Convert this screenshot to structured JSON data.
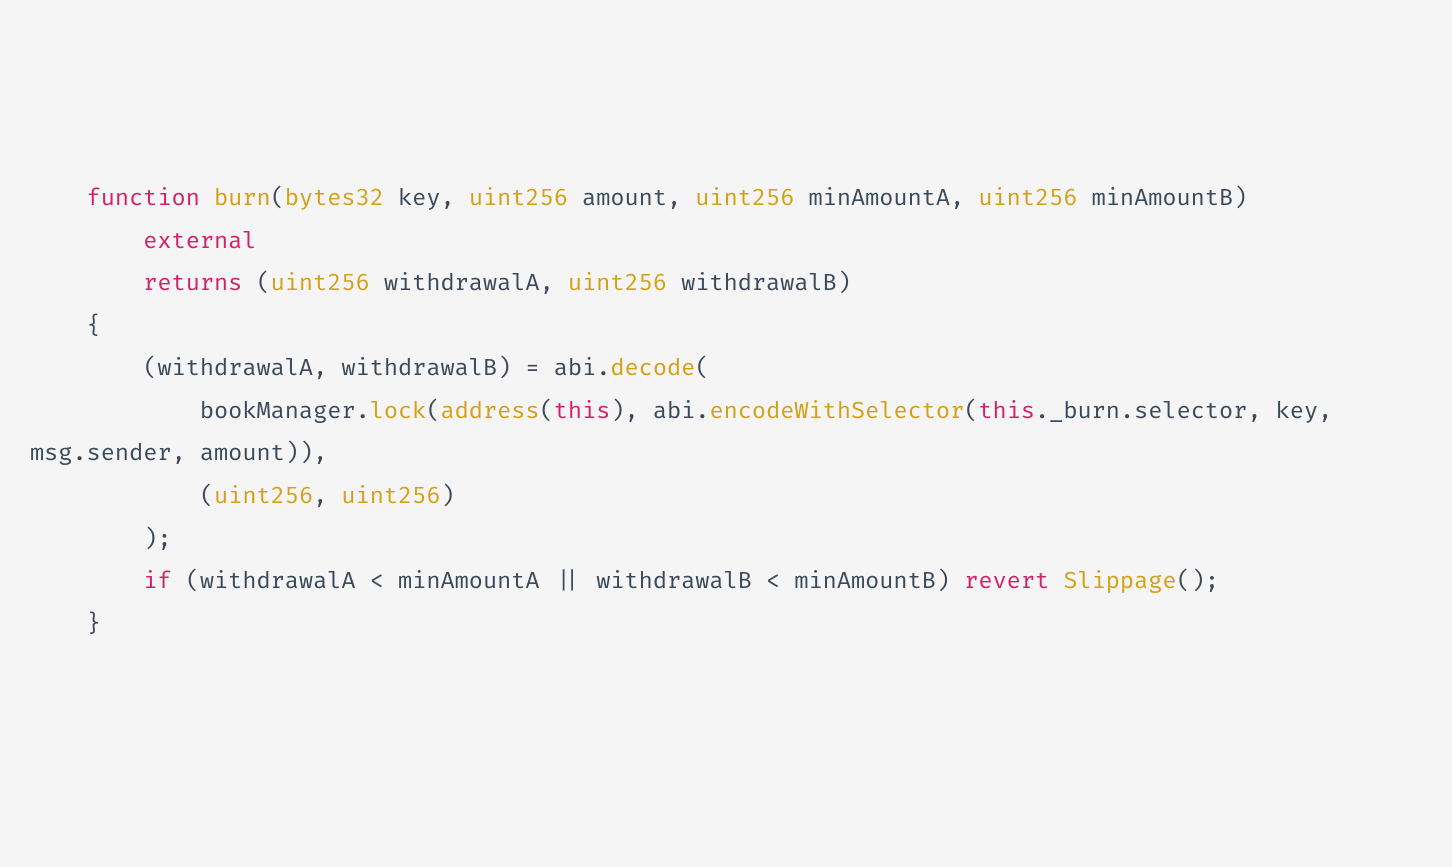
{
  "code": {
    "tokens": [
      {
        "text": "    ",
        "cls": "tok-default"
      },
      {
        "text": "function",
        "cls": "tok-keyword"
      },
      {
        "text": " ",
        "cls": "tok-default"
      },
      {
        "text": "burn",
        "cls": "tok-func"
      },
      {
        "text": "(",
        "cls": "tok-punct"
      },
      {
        "text": "bytes32",
        "cls": "tok-type"
      },
      {
        "text": " key",
        "cls": "tok-default"
      },
      {
        "text": ",",
        "cls": "tok-punct"
      },
      {
        "text": " ",
        "cls": "tok-default"
      },
      {
        "text": "uint256",
        "cls": "tok-type"
      },
      {
        "text": " amount",
        "cls": "tok-default"
      },
      {
        "text": ",",
        "cls": "tok-punct"
      },
      {
        "text": " ",
        "cls": "tok-default"
      },
      {
        "text": "uint256",
        "cls": "tok-type"
      },
      {
        "text": " minAmountA",
        "cls": "tok-default"
      },
      {
        "text": ",",
        "cls": "tok-punct"
      },
      {
        "text": " ",
        "cls": "tok-default"
      },
      {
        "text": "uint256",
        "cls": "tok-type"
      },
      {
        "text": " minAmountB",
        "cls": "tok-default"
      },
      {
        "text": ")",
        "cls": "tok-punct"
      },
      {
        "text": "\n        ",
        "cls": "tok-default"
      },
      {
        "text": "external",
        "cls": "tok-keyword"
      },
      {
        "text": "\n        ",
        "cls": "tok-default"
      },
      {
        "text": "returns",
        "cls": "tok-keyword"
      },
      {
        "text": " ",
        "cls": "tok-default"
      },
      {
        "text": "(",
        "cls": "tok-punct"
      },
      {
        "text": "uint256",
        "cls": "tok-type"
      },
      {
        "text": " withdrawalA",
        "cls": "tok-default"
      },
      {
        "text": ",",
        "cls": "tok-punct"
      },
      {
        "text": " ",
        "cls": "tok-default"
      },
      {
        "text": "uint256",
        "cls": "tok-type"
      },
      {
        "text": " withdrawalB",
        "cls": "tok-default"
      },
      {
        "text": ")",
        "cls": "tok-punct"
      },
      {
        "text": "\n    ",
        "cls": "tok-default"
      },
      {
        "text": "{",
        "cls": "tok-punct"
      },
      {
        "text": "\n        ",
        "cls": "tok-default"
      },
      {
        "text": "(",
        "cls": "tok-punct"
      },
      {
        "text": "withdrawalA",
        "cls": "tok-default"
      },
      {
        "text": ",",
        "cls": "tok-punct"
      },
      {
        "text": " withdrawalB",
        "cls": "tok-default"
      },
      {
        "text": ")",
        "cls": "tok-punct"
      },
      {
        "text": " ",
        "cls": "tok-default"
      },
      {
        "text": "=",
        "cls": "tok-punct"
      },
      {
        "text": " abi",
        "cls": "tok-default"
      },
      {
        "text": ".",
        "cls": "tok-punct"
      },
      {
        "text": "decode",
        "cls": "tok-func"
      },
      {
        "text": "(",
        "cls": "tok-punct"
      },
      {
        "text": "\n            bookManager",
        "cls": "tok-default"
      },
      {
        "text": ".",
        "cls": "tok-punct"
      },
      {
        "text": "lock",
        "cls": "tok-func"
      },
      {
        "text": "(",
        "cls": "tok-punct"
      },
      {
        "text": "address",
        "cls": "tok-type"
      },
      {
        "text": "(",
        "cls": "tok-punct"
      },
      {
        "text": "this",
        "cls": "tok-keyword"
      },
      {
        "text": ")",
        "cls": "tok-punct"
      },
      {
        "text": ",",
        "cls": "tok-punct"
      },
      {
        "text": " abi",
        "cls": "tok-default"
      },
      {
        "text": ".",
        "cls": "tok-punct"
      },
      {
        "text": "encodeWithSelector",
        "cls": "tok-func"
      },
      {
        "text": "(",
        "cls": "tok-punct"
      },
      {
        "text": "this",
        "cls": "tok-keyword"
      },
      {
        "text": ".",
        "cls": "tok-punct"
      },
      {
        "text": "_burn",
        "cls": "tok-default"
      },
      {
        "text": ".",
        "cls": "tok-punct"
      },
      {
        "text": "selector",
        "cls": "tok-default"
      },
      {
        "text": ",",
        "cls": "tok-punct"
      },
      {
        "text": " key",
        "cls": "tok-default"
      },
      {
        "text": ",",
        "cls": "tok-punct"
      },
      {
        "text": " msg",
        "cls": "tok-default"
      },
      {
        "text": ".",
        "cls": "tok-punct"
      },
      {
        "text": "sender",
        "cls": "tok-default"
      },
      {
        "text": ",",
        "cls": "tok-punct"
      },
      {
        "text": " amount",
        "cls": "tok-default"
      },
      {
        "text": "))",
        "cls": "tok-punct"
      },
      {
        "text": ",",
        "cls": "tok-punct"
      },
      {
        "text": "\n            ",
        "cls": "tok-default"
      },
      {
        "text": "(",
        "cls": "tok-punct"
      },
      {
        "text": "uint256",
        "cls": "tok-type"
      },
      {
        "text": ",",
        "cls": "tok-punct"
      },
      {
        "text": " ",
        "cls": "tok-default"
      },
      {
        "text": "uint256",
        "cls": "tok-type"
      },
      {
        "text": ")",
        "cls": "tok-punct"
      },
      {
        "text": "\n        ",
        "cls": "tok-default"
      },
      {
        "text": ")",
        "cls": "tok-punct"
      },
      {
        "text": ";",
        "cls": "tok-punct"
      },
      {
        "text": "\n        ",
        "cls": "tok-default"
      },
      {
        "text": "if",
        "cls": "tok-keyword"
      },
      {
        "text": " ",
        "cls": "tok-default"
      },
      {
        "text": "(",
        "cls": "tok-punct"
      },
      {
        "text": "withdrawalA ",
        "cls": "tok-default"
      },
      {
        "text": "<",
        "cls": "tok-punct"
      },
      {
        "text": " minAmountA ",
        "cls": "tok-default"
      },
      {
        "text": "||",
        "cls": "tok-punct"
      },
      {
        "text": " withdrawalB ",
        "cls": "tok-default"
      },
      {
        "text": "<",
        "cls": "tok-punct"
      },
      {
        "text": " minAmountB",
        "cls": "tok-default"
      },
      {
        "text": ")",
        "cls": "tok-punct"
      },
      {
        "text": " ",
        "cls": "tok-default"
      },
      {
        "text": "revert",
        "cls": "tok-keyword"
      },
      {
        "text": " ",
        "cls": "tok-default"
      },
      {
        "text": "Slippage",
        "cls": "tok-func"
      },
      {
        "text": "()",
        "cls": "tok-punct"
      },
      {
        "text": ";",
        "cls": "tok-punct"
      },
      {
        "text": "\n    ",
        "cls": "tok-default"
      },
      {
        "text": "}",
        "cls": "tok-punct"
      }
    ]
  }
}
